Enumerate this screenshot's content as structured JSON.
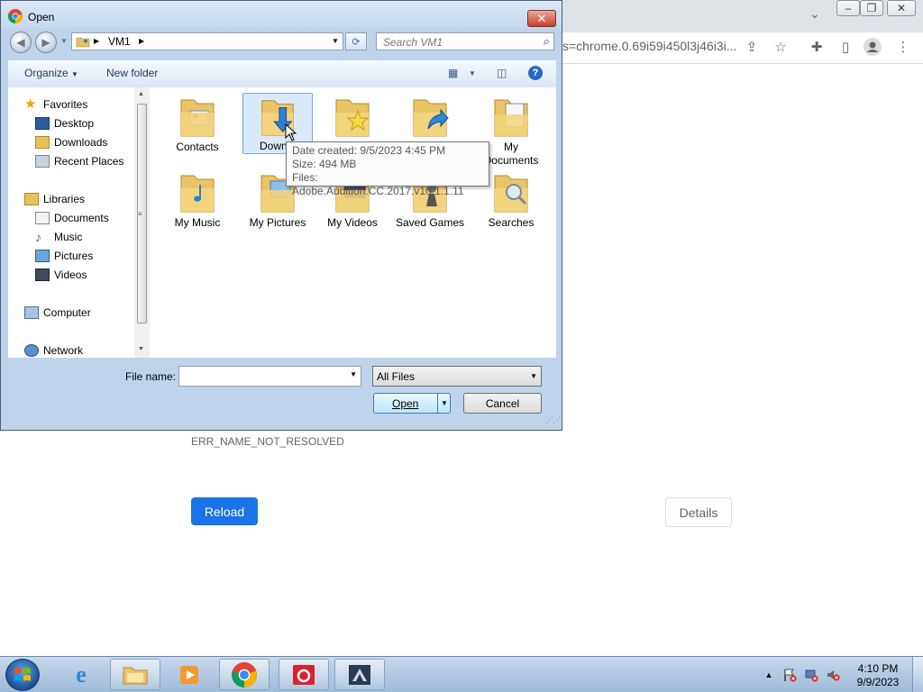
{
  "chrome": {
    "omnibox_text": "s=chrome.0.69i59i450l3j46i3i...",
    "error_code": "ERR_NAME_NOT_RESOLVED",
    "reload_label": "Reload",
    "details_label": "Details",
    "accent_color": "#1a73e8"
  },
  "dialog": {
    "title": "Open",
    "breadcrumb": [
      "VM1"
    ],
    "search_placeholder": "Search VM1",
    "organize_label": "Organize",
    "new_folder_label": "New folder",
    "nav_pane": {
      "items": [
        {
          "label": "Favorites",
          "icon": "star-icon"
        },
        {
          "label": "Desktop",
          "icon": "desktop-icon"
        },
        {
          "label": "Downloads",
          "icon": "downloads-folder-icon"
        },
        {
          "label": "Recent Places",
          "icon": "recent-places-icon"
        },
        {
          "label": "Libraries",
          "icon": "libraries-icon"
        },
        {
          "label": "Documents",
          "icon": "documents-icon"
        },
        {
          "label": "Music",
          "icon": "music-icon"
        },
        {
          "label": "Pictures",
          "icon": "pictures-icon"
        },
        {
          "label": "Videos",
          "icon": "videos-icon"
        },
        {
          "label": "Computer",
          "icon": "computer-icon"
        },
        {
          "label": "Network",
          "icon": "network-icon"
        }
      ]
    },
    "folders": [
      {
        "label": "Contacts",
        "icon": "contacts-folder-icon"
      },
      {
        "label": "Downlo",
        "icon": "downloads-folder-icon",
        "selected": true
      },
      {
        "label": "",
        "icon": "favorites-folder-icon"
      },
      {
        "label": "",
        "icon": "links-folder-icon"
      },
      {
        "label": "My Documents",
        "icon": "documents-folder-icon"
      },
      {
        "label": "My Music",
        "icon": "music-folder-icon"
      },
      {
        "label": "My Pictures",
        "icon": "pictures-folder-icon"
      },
      {
        "label": "My Videos",
        "icon": "videos-folder-icon"
      },
      {
        "label": "Saved Games",
        "icon": "saved-games-folder-icon"
      },
      {
        "label": "Searches",
        "icon": "searches-folder-icon"
      }
    ],
    "tooltip": {
      "line1": "Date created: 9/5/2023 4:45 PM",
      "line2": "Size: 494 MB",
      "line3": "Files: Adobe.Audition.CC.2017.v10.1.1.11"
    },
    "file_name_label": "File name:",
    "file_name_value": "",
    "file_type": "All Files",
    "open_label": "Open",
    "cancel_label": "Cancel"
  },
  "taskbar": {
    "time": "4:10 PM",
    "date": "9/9/2023",
    "apps": [
      "internet-explorer-icon",
      "file-explorer-icon",
      "media-player-icon",
      "chrome-icon",
      "creative-cloud-icon",
      "app-icon"
    ]
  }
}
